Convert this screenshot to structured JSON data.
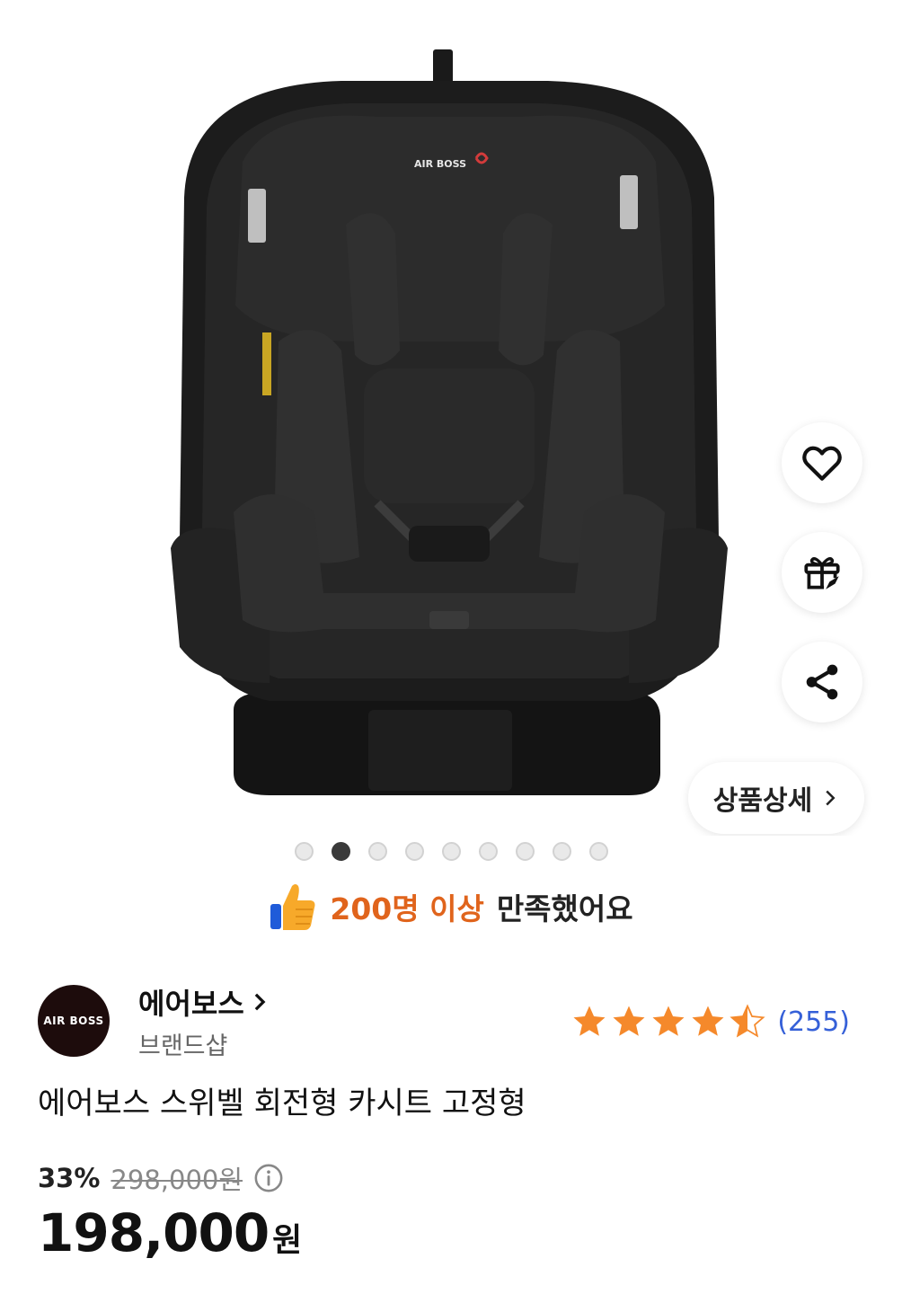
{
  "product_image": {
    "logo_text": "AIR BOSS"
  },
  "actions": {
    "wishlist_icon": "heart-icon",
    "gift_icon": "gift-icon",
    "share_icon": "share-icon",
    "detail_label": "상품상세"
  },
  "carousel": {
    "count": 9,
    "active_index": 1
  },
  "satisfaction": {
    "highlight": "200명 이상",
    "rest": "만족했어요"
  },
  "brand": {
    "logo_text": "AIR BOSS",
    "name": "에어보스",
    "subtitle": "브랜드샵"
  },
  "rating": {
    "stars": 4.5,
    "count": "(255)"
  },
  "product": {
    "title": "에어보스 스위벨 회전형 카시트 고정형",
    "discount": "33%",
    "original_price": "298,000원",
    "price": "198,000",
    "currency": "원"
  },
  "colors": {
    "accent_orange": "#e0641c",
    "star": "#f5892b",
    "link_blue": "#3560d8"
  }
}
